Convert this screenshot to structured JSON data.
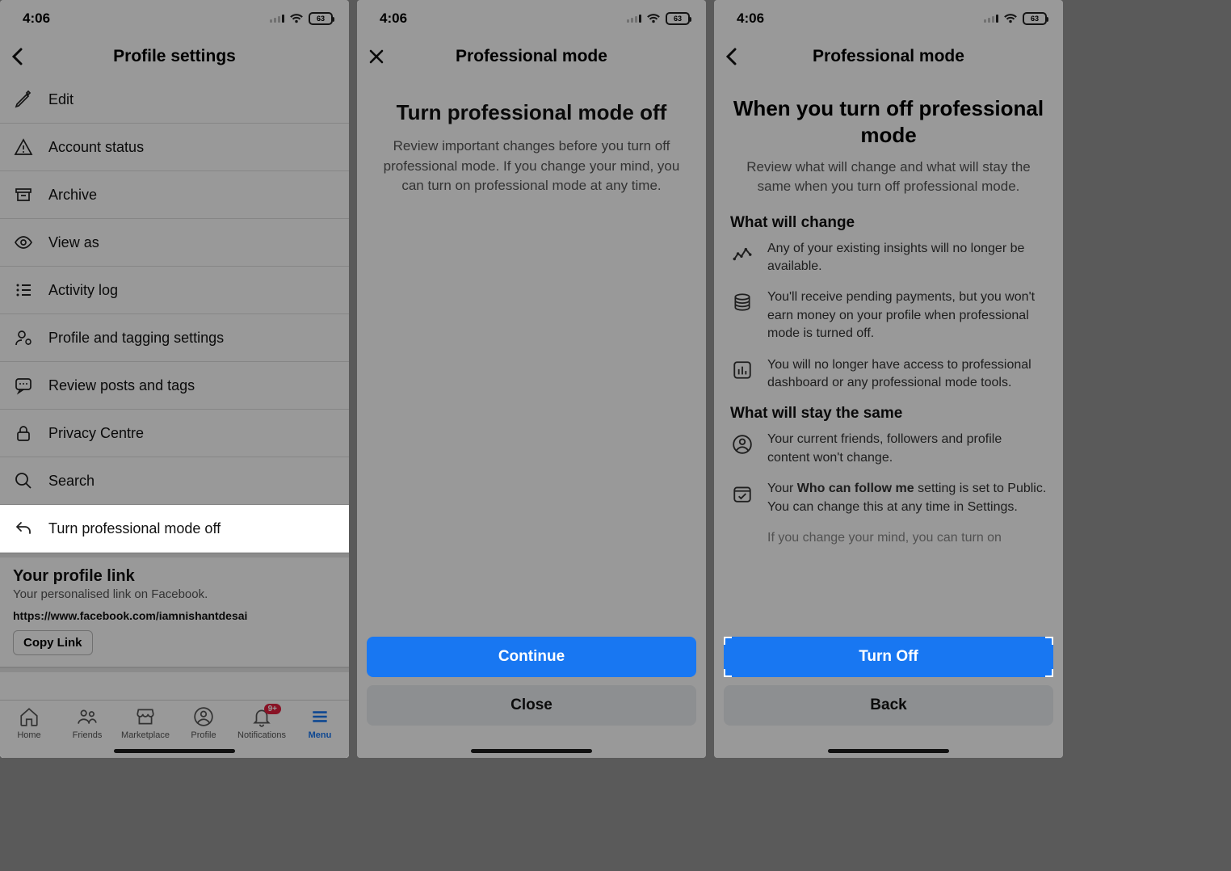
{
  "status": {
    "time": "4:06",
    "battery": "63"
  },
  "screen1": {
    "title": "Profile settings",
    "items": [
      {
        "label": "Edit",
        "icon": "pencil-icon"
      },
      {
        "label": "Account status",
        "icon": "warning-icon"
      },
      {
        "label": "Archive",
        "icon": "archive-icon"
      },
      {
        "label": "View as",
        "icon": "eye-icon"
      },
      {
        "label": "Activity log",
        "icon": "list-icon"
      },
      {
        "label": "Profile and tagging settings",
        "icon": "gear-person-icon"
      },
      {
        "label": "Review posts and tags",
        "icon": "speech-icon"
      },
      {
        "label": "Privacy Centre",
        "icon": "lock-icon"
      },
      {
        "label": "Search",
        "icon": "search-icon"
      },
      {
        "label": "Turn professional mode off",
        "icon": "undo-icon"
      }
    ],
    "profile_link": {
      "heading": "Your profile link",
      "sub": "Your personalised link on Facebook.",
      "url": "https://www.facebook.com/iamnishantdesai",
      "copy": "Copy Link"
    },
    "tabs": [
      {
        "label": "Home",
        "icon": "home-icon"
      },
      {
        "label": "Friends",
        "icon": "friends-icon"
      },
      {
        "label": "Marketplace",
        "icon": "market-icon"
      },
      {
        "label": "Profile",
        "icon": "profile-icon"
      },
      {
        "label": "Notifications",
        "icon": "bell-icon",
        "badge": "9+"
      },
      {
        "label": "Menu",
        "icon": "menu-icon",
        "active": true
      }
    ]
  },
  "screen2": {
    "header": "Professional mode",
    "heading": "Turn professional mode off",
    "lead": "Review important changes before you turn off professional mode. If you change your mind, you can turn on professional mode at any time.",
    "primary": "Continue",
    "secondary": "Close"
  },
  "screen3": {
    "header": "Professional mode",
    "heading": "When you turn off professional mode",
    "lead": "Review what will change and what will stay the same when you turn off professional mode.",
    "change_heading": "What will change",
    "changes": [
      "Any of your existing insights will no longer be available.",
      "You'll receive pending payments, but you won't earn money on your profile when professional mode is turned off.",
      "You will no longer have access to professional dashboard or any professional mode tools."
    ],
    "same_heading": "What will stay the same",
    "sames": [
      {
        "pre": "Your current friends, followers and profile content won't change."
      },
      {
        "pre": "Your ",
        "bold": "Who can follow me",
        "post": " setting is set to Public. You can change this at any time in Settings."
      }
    ],
    "cutoff": "If you change your mind, you can turn on",
    "primary": "Turn Off",
    "secondary": "Back"
  }
}
